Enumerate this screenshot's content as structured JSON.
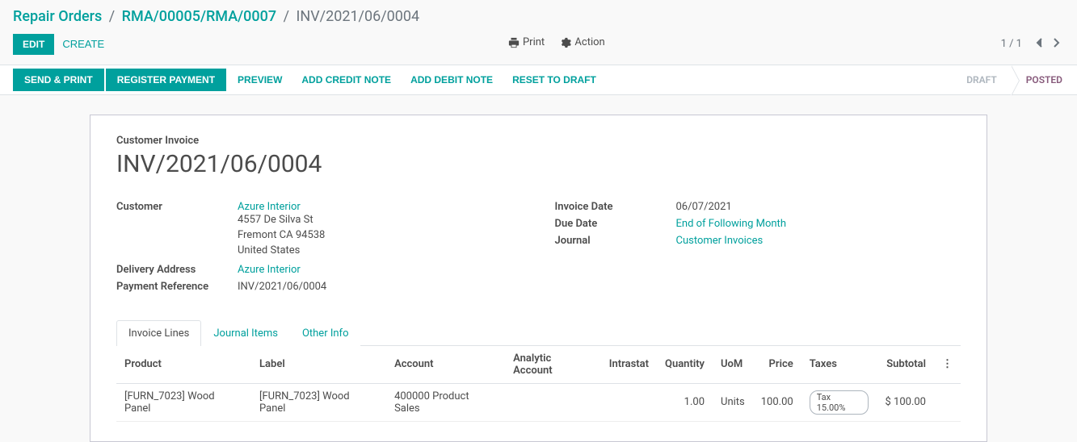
{
  "breadcrumb": {
    "root": "Repair Orders",
    "parent": "RMA/00005/RMA/0007",
    "current": "INV/2021/06/0004"
  },
  "controls": {
    "edit": "EDIT",
    "create": "CREATE",
    "print": "Print",
    "action": "Action",
    "pager": "1 / 1"
  },
  "statusbar": {
    "send_print": "SEND & PRINT",
    "register_payment": "REGISTER PAYMENT",
    "preview": "PREVIEW",
    "add_credit_note": "ADD CREDIT NOTE",
    "add_debit_note": "ADD DEBIT NOTE",
    "reset_to_draft": "RESET TO DRAFT",
    "states": {
      "draft": "DRAFT",
      "posted": "POSTED"
    }
  },
  "title": {
    "label": "Customer Invoice",
    "name": "INV/2021/06/0004"
  },
  "fields": {
    "customer_label": "Customer",
    "customer_name": "Azure Interior",
    "customer_addr1": "4557 De Silva St",
    "customer_addr2": "Fremont CA 94538",
    "customer_addr3": "United States",
    "delivery_label": "Delivery Address",
    "delivery_value": "Azure Interior",
    "payref_label": "Payment Reference",
    "payref_value": "INV/2021/06/0004",
    "invoice_date_label": "Invoice Date",
    "invoice_date": "06/07/2021",
    "due_date_label": "Due Date",
    "due_date": "End of Following Month",
    "journal_label": "Journal",
    "journal": "Customer Invoices"
  },
  "tabs": {
    "invoice_lines": "Invoice Lines",
    "journal_items": "Journal Items",
    "other_info": "Other Info"
  },
  "lines": {
    "headers": {
      "product": "Product",
      "label": "Label",
      "account": "Account",
      "analytic": "Analytic Account",
      "intrastat": "Intrastat",
      "quantity": "Quantity",
      "uom": "UoM",
      "price": "Price",
      "taxes": "Taxes",
      "subtotal": "Subtotal"
    },
    "rows": [
      {
        "product": "[FURN_7023] Wood Panel",
        "label": "[FURN_7023] Wood Panel",
        "account": "400000 Product Sales",
        "analytic": "",
        "intrastat": "",
        "quantity": "1.00",
        "uom": "Units",
        "price": "100.00",
        "tax": "Tax 15.00%",
        "subtotal": "$ 100.00"
      }
    ]
  }
}
